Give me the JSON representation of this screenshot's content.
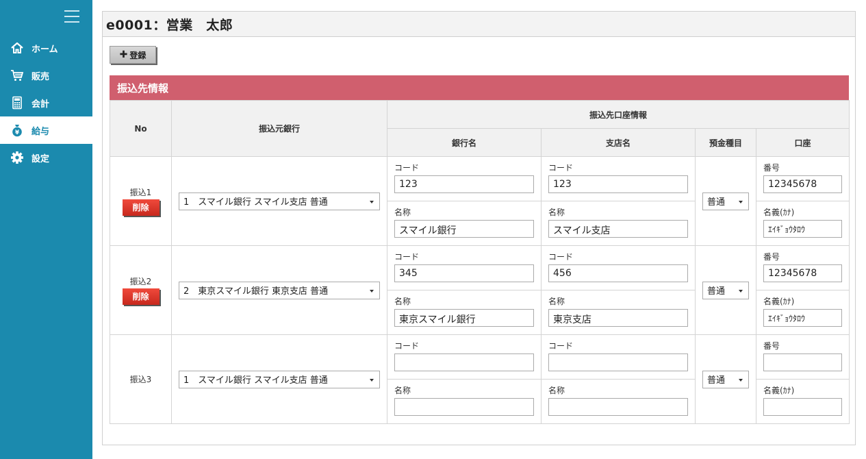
{
  "sidebar": {
    "items": [
      {
        "label": "ホーム",
        "icon": "home-icon"
      },
      {
        "label": "販売",
        "icon": "cart-icon"
      },
      {
        "label": "会計",
        "icon": "calculator-icon"
      },
      {
        "label": "給与",
        "icon": "money-bag-icon",
        "active": true
      },
      {
        "label": "設定",
        "icon": "gear-icon"
      }
    ]
  },
  "header": {
    "title": "e0001：営業　太郎"
  },
  "toolbar": {
    "register_label": "登録"
  },
  "section": {
    "title": "振込先情報"
  },
  "table": {
    "headers": {
      "no": "No",
      "source_bank": "振込元銀行",
      "dest_account": "振込先口座情報",
      "bank_name": "銀行名",
      "branch_name": "支店名",
      "deposit_type": "預金種目",
      "account": "口座"
    },
    "field_labels": {
      "code": "コード",
      "name": "名称",
      "number": "番号",
      "holder": "名義(ｶﾅ)"
    },
    "delete_label": "削除",
    "rows": [
      {
        "no": "振込1",
        "source_bank": "1　スマイル銀行 スマイル支店 普通",
        "bank_code": "123",
        "bank_name": "スマイル銀行",
        "branch_code": "123",
        "branch_name": "スマイル支店",
        "deposit_type": "普通",
        "account_number": "12345678",
        "account_holder": "ｴｲｷﾞｮｳﾀﾛｳ"
      },
      {
        "no": "振込2",
        "source_bank": "2　東京スマイル銀行 東京支店 普通",
        "bank_code": "345",
        "bank_name": "東京スマイル銀行",
        "branch_code": "456",
        "branch_name": "東京支店",
        "deposit_type": "普通",
        "account_number": "12345678",
        "account_holder": "ｴｲｷﾞｮｳﾀﾛｳ"
      },
      {
        "no": "振込3",
        "source_bank": "1　スマイル銀行 スマイル支店 普通",
        "bank_code": "",
        "bank_name": "",
        "branch_code": "",
        "branch_name": "",
        "deposit_type": "普通",
        "account_number": "",
        "account_holder": ""
      }
    ]
  },
  "colors": {
    "sidebar": "#1b8aae",
    "section_bar": "#d05f6e",
    "delete_button": "#e0392c"
  }
}
